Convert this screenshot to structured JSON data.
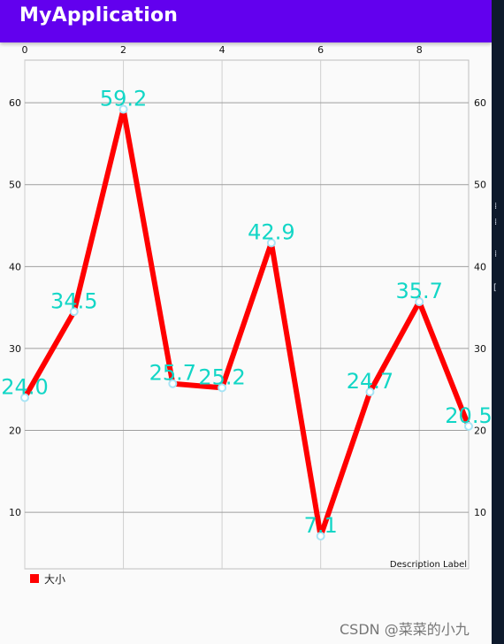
{
  "app": {
    "title": "MyApplication"
  },
  "chart_data": {
    "type": "line",
    "x": [
      0,
      1,
      2,
      3,
      4,
      5,
      6,
      7,
      8,
      9
    ],
    "values": [
      24.0,
      34.5,
      59.2,
      25.7,
      25.2,
      42.9,
      7.1,
      24.7,
      35.7,
      20.5
    ],
    "value_labels": [
      "24.0",
      "34.5",
      "59.2",
      "25.7",
      "25.2",
      "42.9",
      "7.1",
      "24.7",
      "35.7",
      "20.5"
    ],
    "x_ticks": [
      0,
      2,
      4,
      6,
      8
    ],
    "y_ticks": [
      10,
      20,
      30,
      40,
      50,
      60
    ],
    "xlim": [
      0,
      9
    ],
    "ylim": [
      3.1,
      65.2
    ],
    "grid": true,
    "legend": {
      "position": "bottom-left",
      "entries": [
        {
          "label": "大小",
          "color": "#ff0000"
        }
      ]
    },
    "description": "Description Label",
    "series_color": "#ff0000",
    "circle_color": "#a7e4f5",
    "value_label_color": "#12d6c6",
    "grid_color": "#9e9e9e"
  },
  "watermark": "CSDN @菜菜的小九",
  "side_icons": [
    "divider-glyph",
    "bracket-glyph"
  ]
}
